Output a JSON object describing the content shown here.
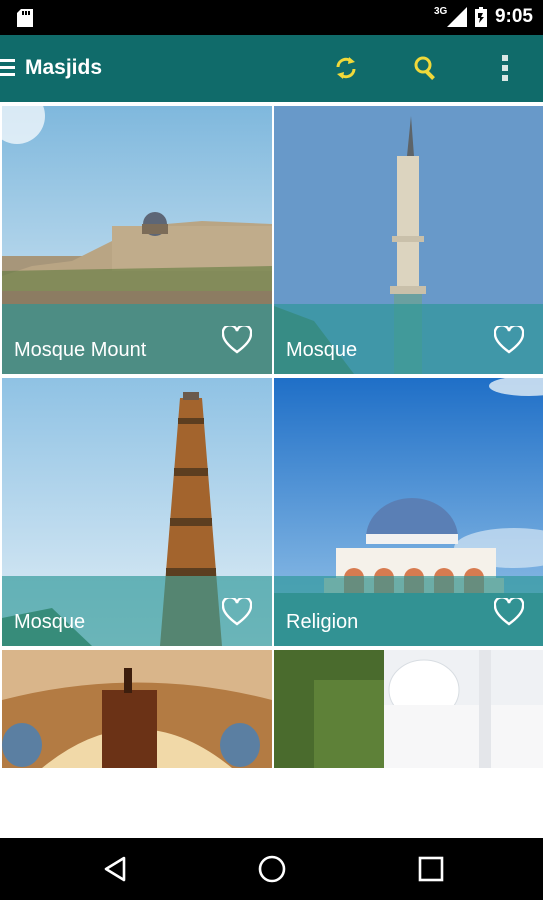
{
  "status_bar": {
    "network": "3G",
    "time": "9:05"
  },
  "app_bar": {
    "title": "Masjids",
    "icons": [
      "menu-icon",
      "sync-icon",
      "search-icon",
      "more-vert-icon"
    ],
    "accent_color": "#f0d93a",
    "background_color": "#106b6a"
  },
  "grid": {
    "items": [
      {
        "label": "Mosque Mount",
        "favorite": false
      },
      {
        "label": "Mosque",
        "favorite": false
      },
      {
        "label": "Mosque",
        "favorite": false
      },
      {
        "label": "Religion",
        "favorite": false
      },
      {
        "label": "",
        "favorite": false
      },
      {
        "label": "",
        "favorite": false
      }
    ]
  },
  "nav_bar": {
    "icons": [
      "back-icon",
      "home-icon",
      "recents-icon"
    ]
  }
}
